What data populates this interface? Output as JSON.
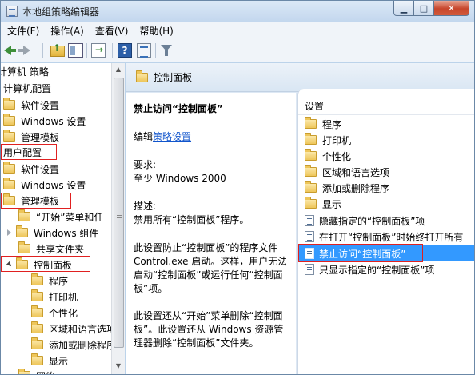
{
  "window": {
    "title": "本地组策略编辑器"
  },
  "caption_buttons": {
    "minimize": "▁",
    "maximize": "□",
    "close": "✕"
  },
  "menu": {
    "items": [
      "文件(F)",
      "操作(A)",
      "查看(V)",
      "帮助(H)"
    ]
  },
  "tree": {
    "items": [
      {
        "label": "计算机 策略"
      },
      {
        "label": "计算机配置"
      },
      {
        "label": "软件设置"
      },
      {
        "label": "Windows 设置"
      },
      {
        "label": "管理模板"
      },
      {
        "label": "用户配置"
      },
      {
        "label": "软件设置"
      },
      {
        "label": "Windows 设置"
      },
      {
        "label": "管理模板"
      },
      {
        "label": "“开始”菜单和任"
      },
      {
        "label": "Windows 组件"
      },
      {
        "label": "共享文件夹"
      },
      {
        "label": "控制面板"
      },
      {
        "label": "程序"
      },
      {
        "label": "打印机"
      },
      {
        "label": "个性化"
      },
      {
        "label": "区域和语言选项"
      },
      {
        "label": "添加或删除程序"
      },
      {
        "label": "显示"
      },
      {
        "label": "网络"
      }
    ]
  },
  "content": {
    "header": "控制面板",
    "description": {
      "title": "禁止访问“控制面板”",
      "edit_prefix": "编辑",
      "edit_link": "策略设置",
      "requirements_label": "要求:",
      "requirements_value": "至少 Windows 2000",
      "description_label": "描述:",
      "description_line": "禁用所有“控制面板”程序。",
      "para1": "此设置防止“控制面板”的程序文件 Control.exe 启动。这样，用户无法启动“控制面板”或运行任何“控制面板”项。",
      "para2": "此设置还从“开始”菜单删除“控制面板”。此设置还从 Windows 资源管理器删除“控制面板”文件夹。"
    },
    "list": {
      "header": "设置",
      "items": [
        {
          "label": "程序",
          "kind": "folder"
        },
        {
          "label": "打印机",
          "kind": "folder"
        },
        {
          "label": "个性化",
          "kind": "folder"
        },
        {
          "label": "区域和语言选项",
          "kind": "folder"
        },
        {
          "label": "添加或删除程序",
          "kind": "folder"
        },
        {
          "label": "显示",
          "kind": "folder"
        },
        {
          "label": "隐藏指定的“控制面板”项",
          "kind": "setting"
        },
        {
          "label": "在打开“控制面板”时始终打开所有",
          "kind": "setting"
        },
        {
          "label": "禁止访问“控制面板”",
          "kind": "setting",
          "selected": true
        },
        {
          "label": "只显示指定的“控制面板”项",
          "kind": "setting"
        }
      ]
    }
  },
  "colors": {
    "selection": "#3399ff",
    "highlight_box": "#e02020",
    "link": "#1155cc"
  }
}
